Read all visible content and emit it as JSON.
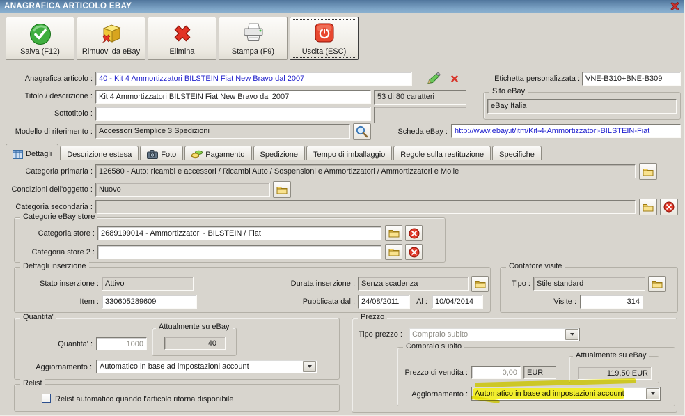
{
  "window": {
    "title": "ANAGRAFICA ARTICOLO EBAY"
  },
  "toolbar": {
    "save_label": "Salva (F12)",
    "remove_label": "Rimuovi da eBay",
    "delete_label": "Elimina",
    "print_label": "Stampa (F9)",
    "exit_label": "Uscita (ESC)"
  },
  "header": {
    "anagrafica_label": "Anagrafica articolo :",
    "anagrafica_value": "40 - Kit 4 Ammortizzatori BILSTEIN Fiat New Bravo dal 2007",
    "titolo_label": "Titolo / descrizione :",
    "titolo_value": "Kit 4 Ammortizzatori BILSTEIN Fiat New Bravo dal 2007",
    "titolo_chars": "53 di 80 caratteri",
    "sottotitolo_label": "Sottotitolo :",
    "sottotitolo_value": "",
    "modello_label": "Modello di riferimento :",
    "modello_value": "Accessori Semplice 3 Spedizioni",
    "etichetta_label": "Etichetta personalizzata :",
    "etichetta_value": "VNE-B310+BNE-B309",
    "sito_group_label": "Sito eBay",
    "sito_value": "eBay Italia",
    "scheda_label": "Scheda eBay :",
    "scheda_url": "http://www.ebay.it/itm/Kit-4-Ammortizzatori-BILSTEIN-Fiat"
  },
  "tabs": [
    {
      "label": "Dettagli",
      "active": true
    },
    {
      "label": "Descrizione estesa"
    },
    {
      "label": "Foto"
    },
    {
      "label": "Pagamento"
    },
    {
      "label": "Spedizione"
    },
    {
      "label": "Tempo di imballaggio"
    },
    {
      "label": "Regole sulla restituzione"
    },
    {
      "label": "Specifiche"
    }
  ],
  "categorie": {
    "primaria_label": "Categoria primaria :",
    "primaria_value": "126580 - Auto: ricambi e accessori / Ricambi Auto / Sospensioni e Ammortizzatori / Ammortizzatori e Molle",
    "condizioni_label": "Condizioni dell'oggetto :",
    "condizioni_value": "Nuovo",
    "secondaria_label": "Categoria secondaria :",
    "secondaria_value": "",
    "store_group_label": "Categorie eBay store",
    "store_label": "Categoria store :",
    "store_value": "2689199014 - Ammortizzatori - BILSTEIN / Fiat",
    "store2_label": "Categoria store 2 :",
    "store2_value": ""
  },
  "inserzione": {
    "group_label": "Dettagli inserzione",
    "stato_label": "Stato inserzione :",
    "stato_value": "Attivo",
    "item_label": "Item :",
    "item_value": "330605289609",
    "durata_label": "Durata inserzione :",
    "durata_value": "Senza scadenza",
    "pubblicata_label": "Pubblicata dal :",
    "pubblicata_value": "24/08/2011",
    "al_label": "Al :",
    "al_value": "10/04/2014"
  },
  "contatore": {
    "group_label": "Contatore visite",
    "tipo_label": "Tipo :",
    "tipo_value": "Stile standard",
    "visite_label": "Visite :",
    "visite_value": "314"
  },
  "quantita": {
    "group_label": "Quantita'",
    "label": "Quantita' :",
    "value": "1000",
    "attualmente_group_label": "Attualmente su eBay",
    "attualmente_value": "40",
    "aggiornamento_label": "Aggiornamento :",
    "aggiornamento_value": "Automatico in base ad impostazioni account"
  },
  "prezzo": {
    "group_label": "Prezzo",
    "tipo_label": "Tipo prezzo :",
    "tipo_value": "Compralo subito",
    "compralo_group_label": "Compralo subito",
    "vendita_label": "Prezzo di vendita :",
    "vendita_value": "0,00",
    "vendita_currency": "EUR",
    "attualmente_group_label": "Attualmente su eBay",
    "attualmente_value": "119,50 EUR",
    "aggiornamento_label": "Aggiornamento :",
    "aggiornamento_value": "Automatico in base ad impostazioni account"
  },
  "relist": {
    "group_label": "Relist",
    "checkbox_label": "Relist automatico quando l'articolo ritorna disponibile",
    "checkbox_checked": false
  },
  "colors": {
    "titlebar_top": "#51769d",
    "titlebar_bottom": "#8ab0cf",
    "window_bg": "#d8d5ce",
    "link": "#1a1acd",
    "record_link": "#2222cc",
    "highlight": "#f0ea00"
  }
}
